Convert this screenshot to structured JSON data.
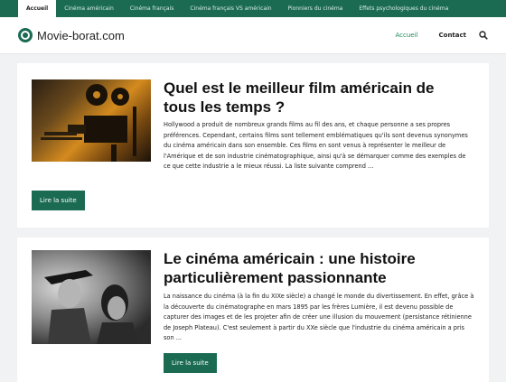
{
  "topnav": {
    "items": [
      {
        "label": "Accueil"
      },
      {
        "label": "Cinéma américain"
      },
      {
        "label": "Cinéma français"
      },
      {
        "label": "Cinéma français VS américain"
      },
      {
        "label": "Pionniers du cinéma"
      },
      {
        "label": "Effets psychologiques du cinéma"
      }
    ]
  },
  "header": {
    "logo_text": "Movie-borat.com",
    "nav": [
      {
        "label": "Accueil"
      },
      {
        "label": "Contact"
      }
    ]
  },
  "colors": {
    "brand_green": "#1b6b53",
    "active_link": "#1b8a5a"
  },
  "posts": [
    {
      "title": "Quel est le meilleur film américain de tous les temps ?",
      "excerpt": "Hollywood a produit de nombreux grands films au fil des ans, et chaque personne a ses propres préférences. Cependant, certains films sont tellement emblématiques qu'ils sont devenus synonymes du cinéma américain dans son ensemble. Ces films en sont venus à représenter le meilleur de l'Amérique et de son industrie cinématographique, ainsi qu'à se démarquer comme des exemples de ce que cette industrie a le mieux réussi. La liste suivante comprend ...",
      "button": "Lire la suite"
    },
    {
      "title": "Le cinéma américain : une histoire particulièrement passionnante",
      "excerpt": "La naissance du cinéma (à la fin du XIXe siècle) a changé le monde du divertissement. En effet, grâce à la découverte du cinématographe en mars 1895 par les frères Lumière, il est devenu possible de capturer des images et de les projeter afin de créer une illusion du mouvement (persistance rétinienne de Joseph Plateau). C'est seulement à partir du XXe siècle que l'industrie du cinéma américain a pris son ...",
      "button": "Lire la suite"
    }
  ]
}
